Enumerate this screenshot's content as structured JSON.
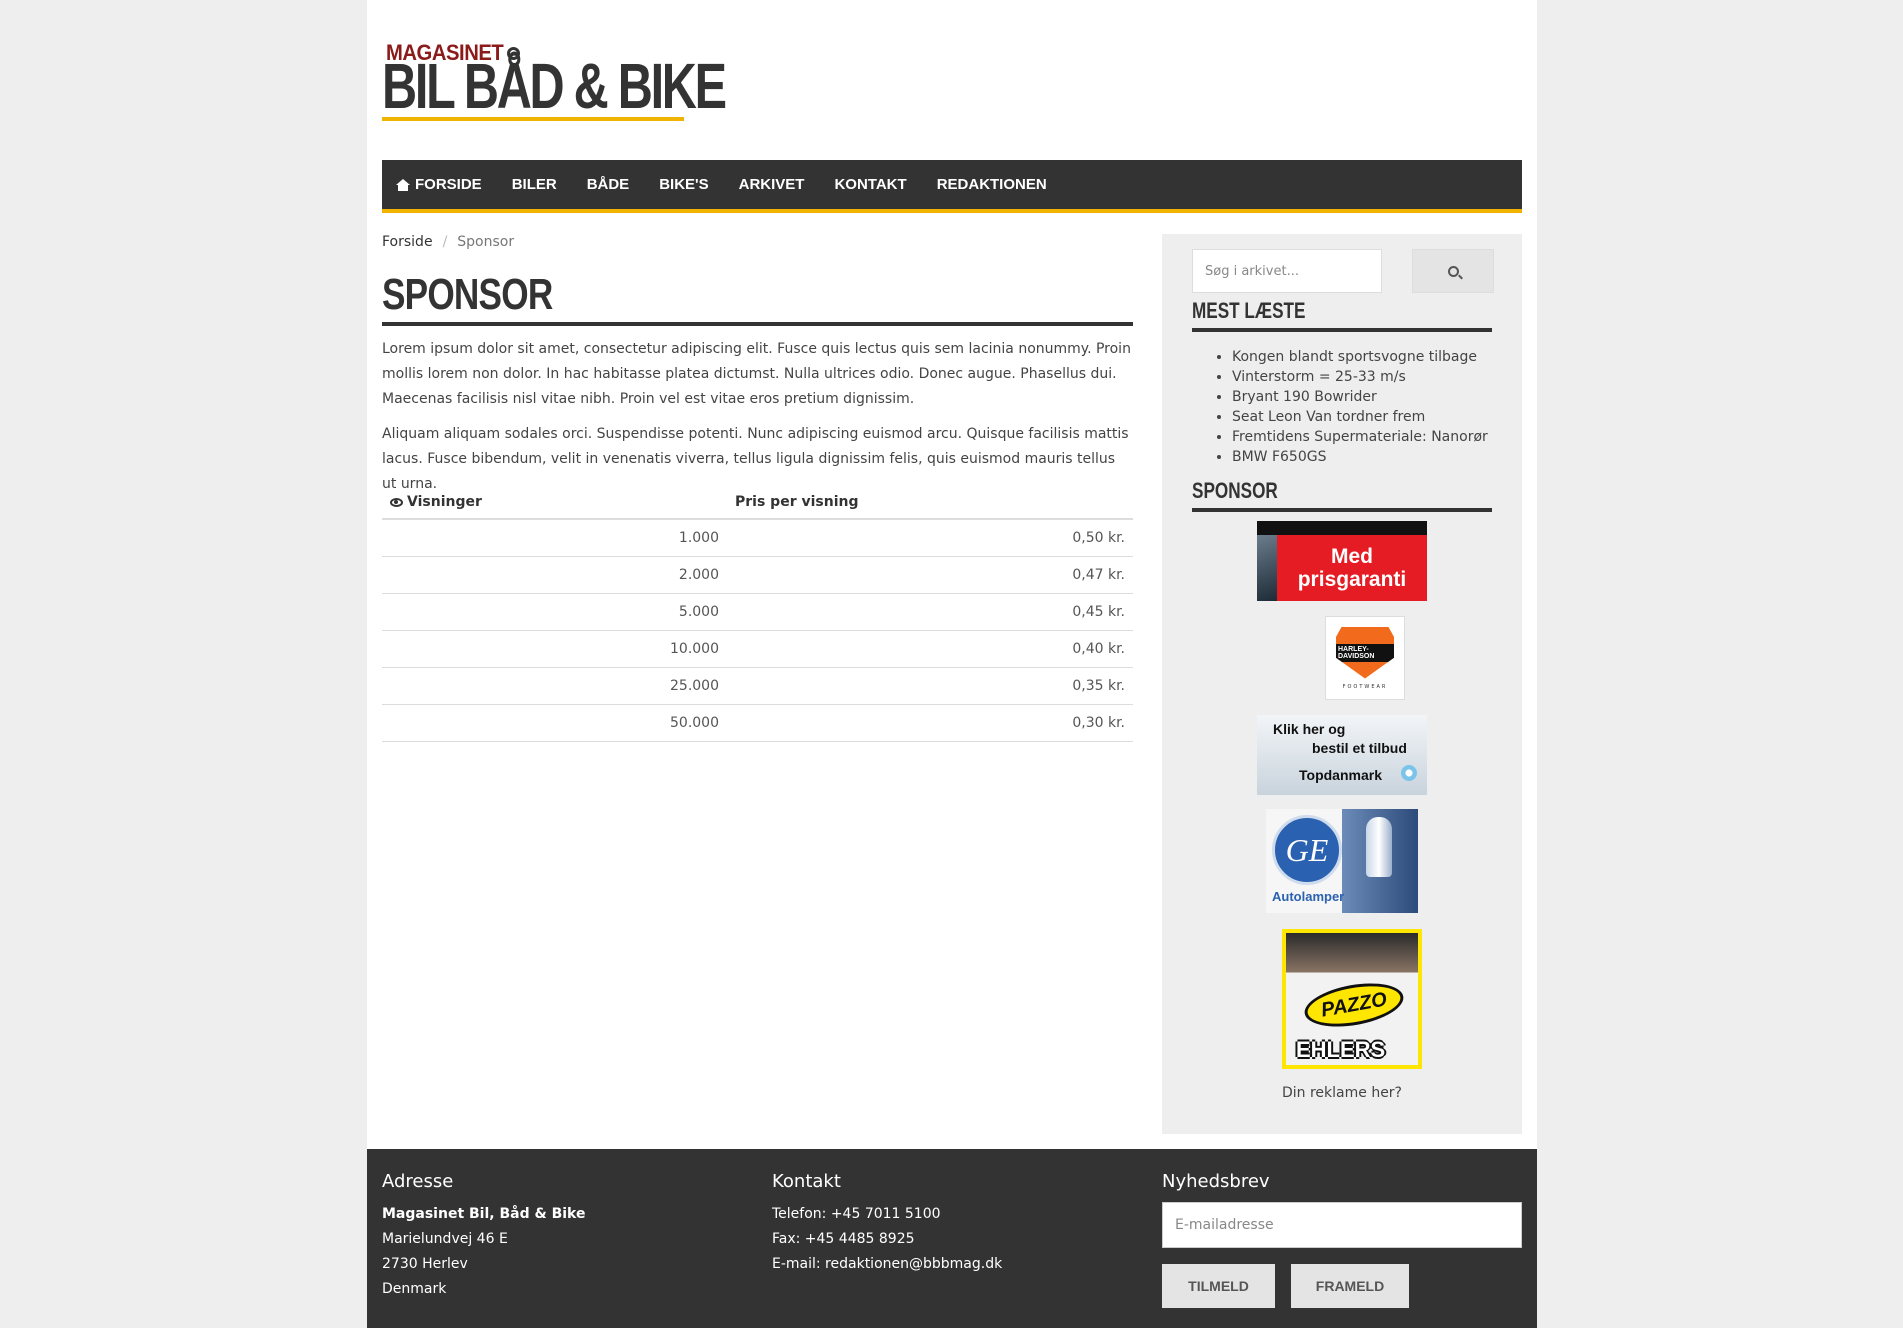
{
  "logo": {
    "top_text": "MAGASINET",
    "main_text": "BIL BÅD & BIKE"
  },
  "nav": {
    "items": [
      "FORSIDE",
      "BILER",
      "BÅDE",
      "BIKE'S",
      "ARKIVET",
      "KONTAKT",
      "REDAKTIONEN"
    ]
  },
  "breadcrumb": {
    "home": "Forside",
    "separator": "/",
    "current": "Sponsor"
  },
  "page": {
    "title": "SPONSOR",
    "paragraphs": [
      "Lorem ipsum dolor sit amet, consectetur adipiscing elit. Fusce quis lectus quis sem lacinia nonummy. Proin mollis lorem non dolor. In hac habitasse platea dictumst. Nulla ultrices odio. Donec augue. Phasellus dui. Maecenas facilisis nisl vitae nibh. Proin vel est vitae eros pretium dignissim.",
      "Aliquam aliquam sodales orci. Suspendisse potenti. Nunc adipiscing euismod arcu. Quisque facilisis mattis lacus. Fusce bibendum, velit in venenatis viverra, tellus ligula dignissim felis, quis euismod mauris tellus ut urna."
    ]
  },
  "price_table": {
    "headers": [
      "Visninger",
      "Pris per visning"
    ],
    "rows": [
      [
        "1.000",
        "0,50 kr."
      ],
      [
        "2.000",
        "0,47 kr."
      ],
      [
        "5.000",
        "0,45 kr."
      ],
      [
        "10.000",
        "0,40 kr."
      ],
      [
        "25.000",
        "0,35 kr."
      ],
      [
        "50.000",
        "0,30 kr."
      ]
    ]
  },
  "sidebar": {
    "search_placeholder": "Søg i arkivet...",
    "most_read_heading": "MEST LÆSTE",
    "most_read": [
      "Kongen blandt sportsvogne tilbage",
      "Vinterstorm = 25-33 m/s",
      "Bryant 190 Bowrider",
      "Seat Leon Van tordner frem",
      "Fremtidens Supermateriale: Nanorør",
      "BMW F650GS"
    ],
    "sponsor_heading": "SPONSOR",
    "ads": {
      "ad1_text": "Med prisgaranti",
      "ad2_text": "HARLEY-DAVIDSON",
      "ad2_sub": "FOOTWEAR",
      "ad3_line1": "Klik her og",
      "ad3_line2": "bestil et tilbud",
      "ad3_brand": "Topdanmark",
      "ad4_logo": "GE",
      "ad4_text": "Autolamper",
      "ad5_brand": "PAZZO",
      "ad5_text": "EHLERS PM"
    },
    "ad_caption": "Din reklame her?"
  },
  "footer": {
    "address": {
      "heading": "Adresse",
      "name": "Magasinet Bil, Båd & Bike",
      "street": "Marielundvej 46 E",
      "city": "2730 Herlev",
      "country": "Denmark"
    },
    "contact": {
      "heading": "Kontakt",
      "phone": "Telefon: +45 7011 5100",
      "fax": "Fax: +45 4485 8925",
      "email": "E-mail: redaktionen@bbbmag.dk"
    },
    "newsletter": {
      "heading": "Nyhedsbrev",
      "placeholder": "E-mailadresse",
      "subscribe": "TILMELD",
      "unsubscribe": "FRAMELD"
    }
  },
  "colors": {
    "accent": "#f0b400",
    "dark": "#333333",
    "logo_red": "#8b1a1a"
  }
}
